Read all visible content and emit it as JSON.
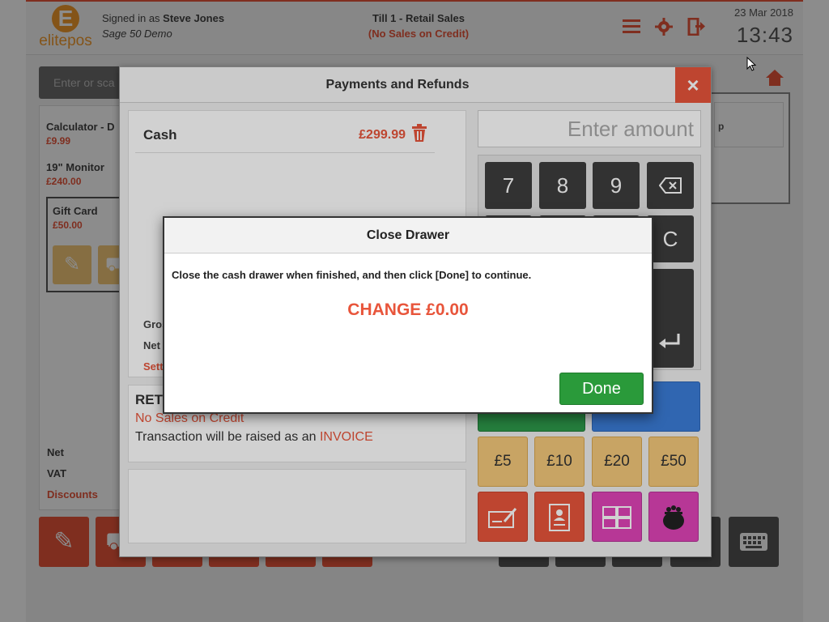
{
  "header": {
    "logo_mark": "E",
    "logo_text": "elitepos",
    "signed_in_prefix": "Signed in as ",
    "user_name": "Steve Jones",
    "company": "Sage 50 Demo",
    "till_name": "Till 1 - Retail Sales",
    "till_status": "(No Sales on Credit)",
    "date": "23 Mar 2018",
    "time": "13:43"
  },
  "search": {
    "placeholder": "Enter or sca"
  },
  "basket": {
    "items": [
      {
        "name": "Calculator - D",
        "price": "£9.99"
      },
      {
        "name": "19\" Monitor",
        "price": "£240.00"
      },
      {
        "name": "Gift Card",
        "price": "£50.00"
      }
    ],
    "totals": [
      "Net",
      "VAT",
      "Discounts"
    ]
  },
  "right_panel": {
    "label": "p"
  },
  "payments_modal": {
    "title": "Payments and Refunds",
    "close_label": "×",
    "payment_lines": [
      {
        "method": "Cash",
        "amount": "£299.99"
      }
    ],
    "summary_labels": [
      "Gross",
      "Net",
      "Settle"
    ],
    "info_title": "RET",
    "info_no_credit": "No Sales on Credit",
    "info_invoice_prefix": "Transaction will be raised as an ",
    "info_invoice_word": "INVOICE",
    "amount_placeholder": "Enter amount",
    "keys": {
      "k7": "7",
      "k8": "8",
      "k9": "9",
      "clear": "C"
    },
    "tenders": [
      "£5",
      "£10",
      "£20",
      "£50"
    ]
  },
  "close_drawer": {
    "title": "Close Drawer",
    "message": "Close the cash drawer when finished, and then click [Done] to continue.",
    "change": "CHANGE £0.00",
    "done_label": "Done"
  },
  "colors": {
    "accent": "#e8553b",
    "brand": "#f29a2e",
    "done_green": "#2a9a3a",
    "key_dark": "#3d3d3d",
    "tender_yellow": "#f5c97a",
    "card_blue": "#3b7dd8",
    "pink": "#e044b8"
  }
}
